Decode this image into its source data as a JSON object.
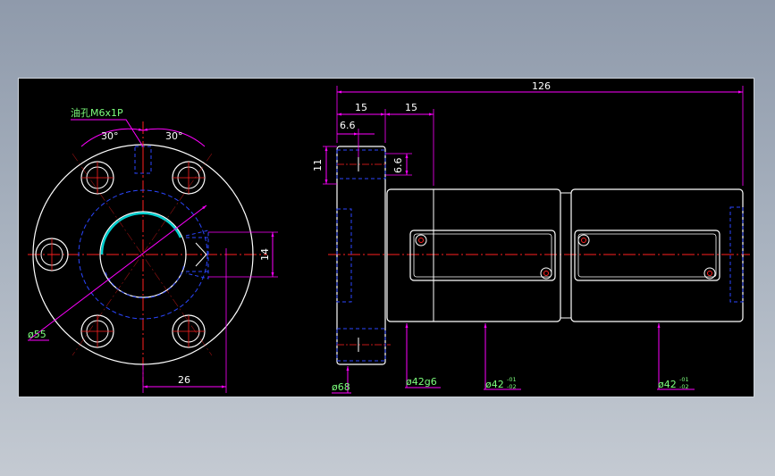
{
  "drawing": {
    "note_oil_hole": "油孔M6x1P",
    "angle_left": "30°",
    "angle_right": "30°",
    "dia_pitch": "ø55",
    "dim_26": "26",
    "dim_14": "14",
    "dim_126": "126",
    "dim_15a": "15",
    "dim_15b": "15",
    "dim_6_6_h": "6.6",
    "dim_6_6_v": "6.6",
    "dim_11": "11",
    "dia_68": "ø68",
    "dia_42g6": "ø42g6",
    "dia_42a": "ø42",
    "tol_a_upper": "-01",
    "tol_a_lower": "-02",
    "dia_42b": "ø42",
    "tol_b_upper": "-01",
    "tol_b_lower": "-02"
  },
  "colors": {
    "background": "#000000",
    "outline": "#ffffff",
    "hidden": "#2b46ff",
    "center": "#ff2020",
    "dimension": "#ff00ff",
    "text": "#ffffff",
    "dim_text_green": "#7dff7d"
  }
}
